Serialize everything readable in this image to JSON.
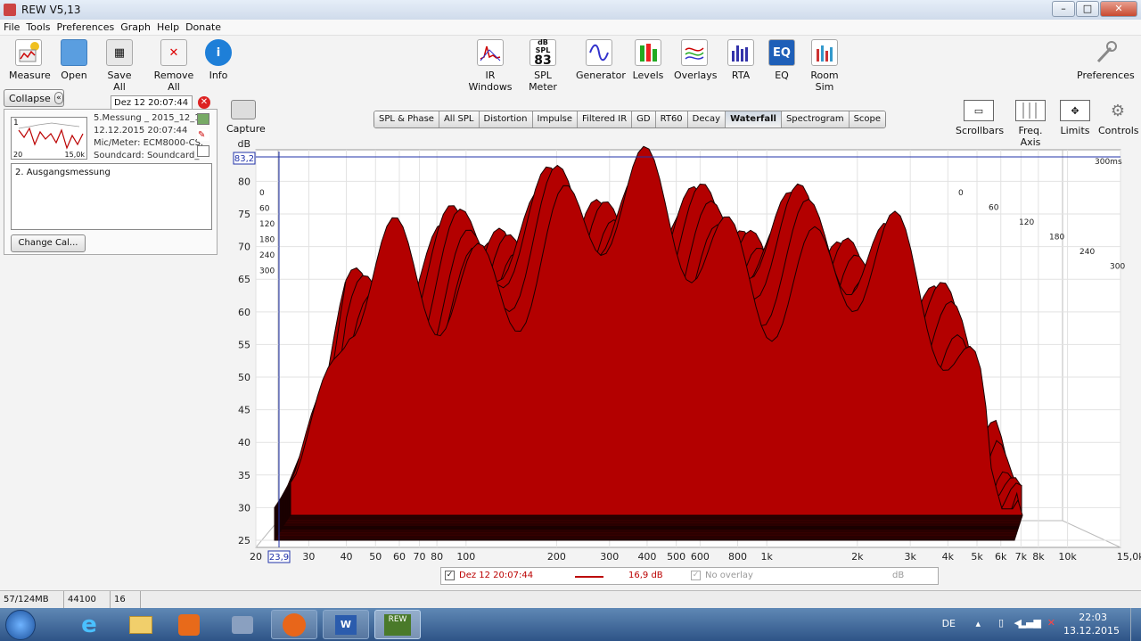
{
  "window": {
    "title": "REW V5,13"
  },
  "menu": [
    "File",
    "Tools",
    "Preferences",
    "Graph",
    "Help",
    "Donate"
  ],
  "toolbar": {
    "measure": "Measure",
    "open": "Open",
    "save_all": "Save All",
    "remove_all": "Remove All",
    "info": "Info",
    "ir_windows": "IR Windows",
    "spl_meter": "SPL Meter",
    "spl_icon_label": "dB SPL",
    "spl_icon_value": "83",
    "generator": "Generator",
    "levels": "Levels",
    "overlays": "Overlays",
    "rta": "RTA",
    "eq": "EQ",
    "eq_icon": "EQ",
    "room_sim": "Room Sim",
    "preferences": "Preferences"
  },
  "left": {
    "collapse": "Collapse",
    "date": "Dez 12 20:07:44",
    "thumb_index": "1",
    "thumb_x_start": "20",
    "thumb_x_end": "15,0k",
    "info": [
      "5.Messung _ 2015_12_1",
      "12.12.2015 20:07:44",
      "Mic/Meter: ECM8000-CS.",
      "Soundcard: Soundcard_"
    ],
    "notes": "2. Ausgangsmessung",
    "change_cal": "Change Cal..."
  },
  "capture": "Capture",
  "tabs": [
    "SPL & Phase",
    "All SPL",
    "Distortion",
    "Impulse",
    "Filtered IR",
    "GD",
    "RT60",
    "Decay",
    "Waterfall",
    "Spectrogram",
    "Scope"
  ],
  "active_tab": "Waterfall",
  "right_controls": {
    "scrollbars": "Scrollbars",
    "freq_axis": "Freq. Axis",
    "limits": "Limits",
    "controls": "Controls"
  },
  "chart_data": {
    "type": "waterfall",
    "ylabel": "dB",
    "y_ticks": [
      80,
      75,
      70,
      65,
      60,
      55,
      50,
      45,
      40,
      35,
      30,
      25
    ],
    "ylim": [
      25,
      83.2
    ],
    "cursor_y": "83,2",
    "cursor_x": "23,9",
    "x_ticks": [
      "20",
      "30",
      "40",
      "50",
      "60",
      "70",
      "80",
      "100",
      "200",
      "300",
      "400",
      "500",
      "600",
      "800",
      "1k",
      "2k",
      "3k",
      "4k",
      "5k",
      "6k",
      "7k",
      "8k",
      "10k",
      "15,0k Hz"
    ],
    "x_tick_values": [
      20,
      30,
      40,
      50,
      60,
      70,
      80,
      100,
      200,
      300,
      400,
      500,
      600,
      800,
      1000,
      2000,
      3000,
      4000,
      5000,
      6000,
      7000,
      8000,
      10000,
      15000
    ],
    "time_ticks": [
      "0",
      "60",
      "120",
      "180",
      "240",
      "300"
    ],
    "time_end_label": "300ms",
    "color": "#b30000"
  },
  "legend": {
    "series": "Dez 12 20:07:44",
    "value": "16,9 dB",
    "no_overlay": "No overlay",
    "unit": "dB"
  },
  "status": [
    "57/124MB",
    "44100 Hz",
    "16 Bit"
  ],
  "tray": {
    "lang": "DE",
    "time": "22:03",
    "date": "13.12.2015"
  },
  "taskbar_rew": "REW"
}
